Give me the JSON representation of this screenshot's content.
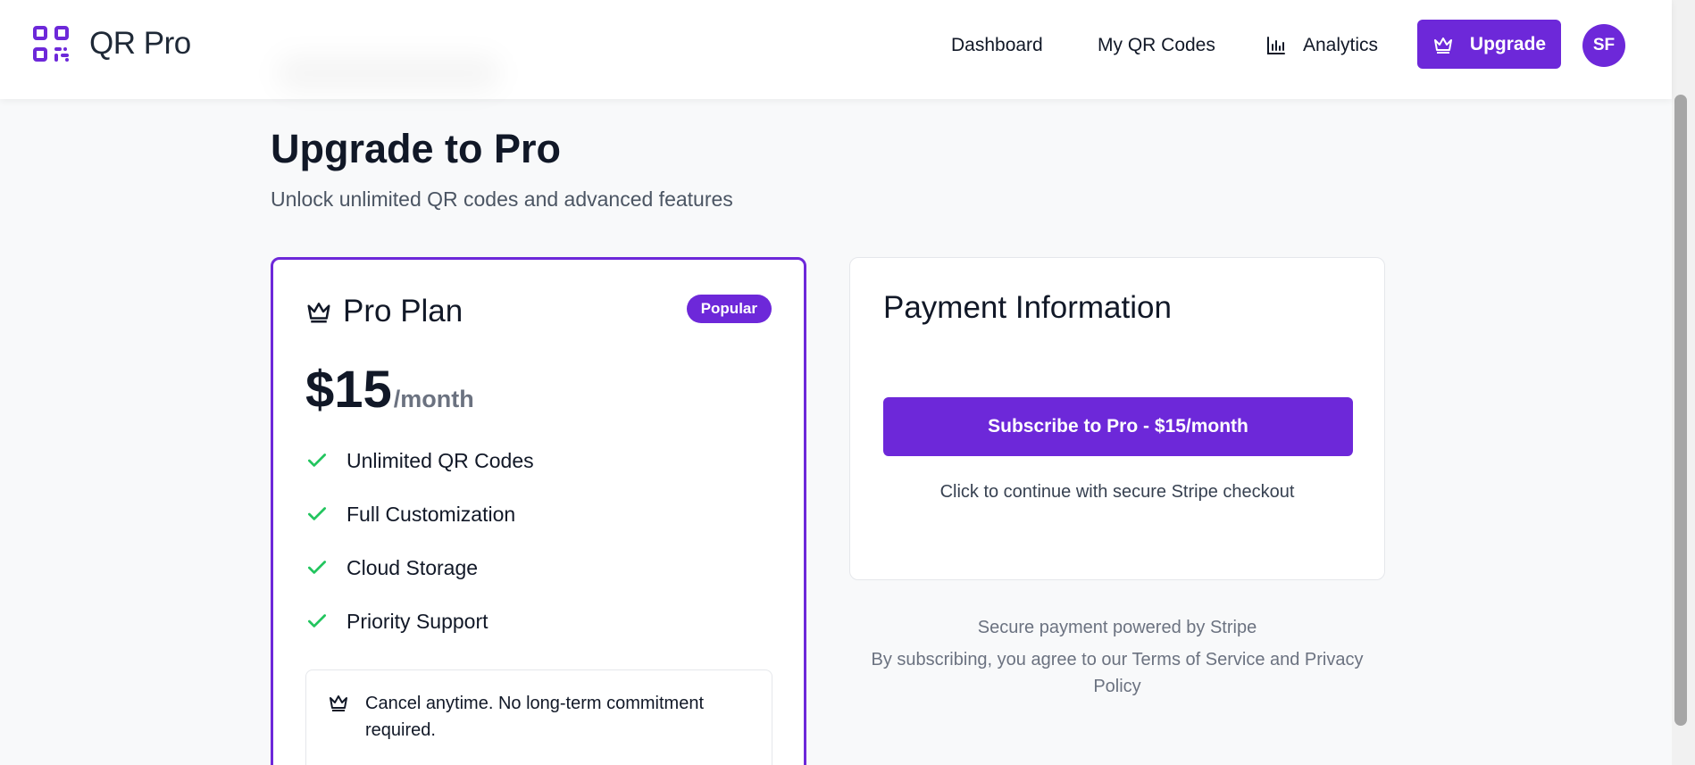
{
  "header": {
    "brand": "QR Pro",
    "nav": [
      "Dashboard",
      "My QR Codes",
      "Analytics"
    ],
    "upgrade_label": "Upgrade",
    "avatar_initials": "SF"
  },
  "main": {
    "title": "Upgrade to Pro",
    "subtitle": "Unlock unlimited QR codes and advanced features"
  },
  "plan": {
    "name": "Pro Plan",
    "badge": "Popular",
    "price": "$15",
    "period": "/month",
    "features": [
      "Unlimited QR Codes",
      "Full Customization",
      "Cloud Storage",
      "Priority Support"
    ],
    "note": "Cancel anytime. No long-term commitment required."
  },
  "payment": {
    "title": "Payment Information",
    "subscribe_label": "Subscribe to Pro - $15/month",
    "hint": "Click to continue with secure Stripe checkout"
  },
  "footer": {
    "secure": "Secure payment powered by Stripe",
    "terms": "By subscribing, you agree to our Terms of Service and Privacy Policy"
  },
  "colors": {
    "accent": "#6d28d9",
    "check": "#22c55e",
    "page_bg": "#f8f9fa"
  },
  "icons": [
    "qr-logo-icon",
    "bar-chart-icon",
    "crown-icon",
    "check-icon"
  ]
}
